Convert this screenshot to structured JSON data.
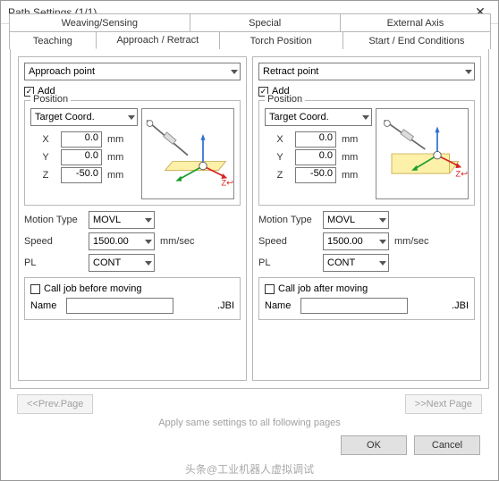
{
  "title": "Path Settings  (1/1)",
  "tabs_row1": [
    "Weaving/Sensing",
    "Special",
    "External Axis"
  ],
  "tabs_row2": [
    "Teaching",
    "Approach / Retract",
    "Torch Position",
    "Start / End Conditions"
  ],
  "active_tab": "Approach / Retract",
  "approach": {
    "point_dd": "Approach point",
    "add": "Add",
    "position_legend": "Position",
    "coord_dd": "Target Coord.",
    "x": "0.0",
    "y": "0.0",
    "z": "-50.0",
    "xl": "X",
    "yl": "Y",
    "zl": "Z",
    "mm": "mm",
    "motion_type_lbl": "Motion Type",
    "motion_type": "MOVL",
    "speed_lbl": "Speed",
    "speed": "1500.00",
    "speed_unit": "mm/sec",
    "pl_lbl": "PL",
    "pl": "CONT",
    "calljob_lbl": "Call job before moving",
    "name_lbl": "Name",
    "name_val": "",
    "ext": ".JBI"
  },
  "retract": {
    "point_dd": "Retract point",
    "add": "Add",
    "position_legend": "Position",
    "coord_dd": "Target Coord.",
    "x": "0.0",
    "y": "0.0",
    "z": "-50.0",
    "xl": "X",
    "yl": "Y",
    "zl": "Z",
    "mm": "mm",
    "motion_type_lbl": "Motion Type",
    "motion_type": "MOVL",
    "speed_lbl": "Speed",
    "speed": "1500.00",
    "speed_unit": "mm/sec",
    "pl_lbl": "PL",
    "pl": "CONT",
    "calljob_lbl": "Call job after moving",
    "name_lbl": "Name",
    "name_val": "",
    "ext": ".JBI"
  },
  "nav": {
    "prev": "<<Prev.Page",
    "next": ">>Next Page",
    "apply_all": "Apply same settings to all following pages"
  },
  "dlg": {
    "ok": "OK",
    "cancel": "Cancel"
  },
  "watermark": "头条@工业机器人虚拟调试"
}
